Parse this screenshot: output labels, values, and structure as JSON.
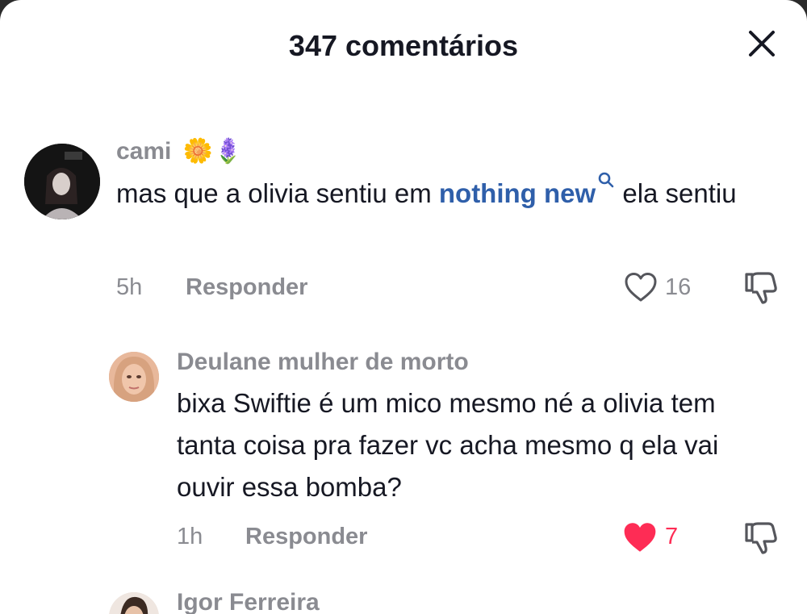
{
  "header": {
    "title": "347 comentários"
  },
  "icons": {
    "close": "close-icon",
    "like": "heart-outline-icon",
    "liked": "heart-filled-icon",
    "dislike": "thumbs-down-icon",
    "search": "search-icon"
  },
  "colors": {
    "link": "#2f5faa",
    "liked": "#fe2c55",
    "muted": "#8a8b91",
    "text": "#161823"
  },
  "comments": [
    {
      "username": "cami",
      "username_emoji": "🌼🪻",
      "text_before": "mas que a olivia sentiu em",
      "link_text": "nothing new",
      "text_after": "ela sentiu",
      "time": "5h",
      "reply_label": "Responder",
      "likes": "16",
      "liked": false
    },
    {
      "username": "Deulane mulher de morto",
      "text": "bixa Swiftie é um mico mesmo né a olivia tem tanta coisa pra fazer vc acha mesmo q ela vai ouvir essa bomba?",
      "time": "1h",
      "reply_label": "Responder",
      "likes": "7",
      "liked": true
    },
    {
      "username": "Igor Ferreira"
    }
  ]
}
